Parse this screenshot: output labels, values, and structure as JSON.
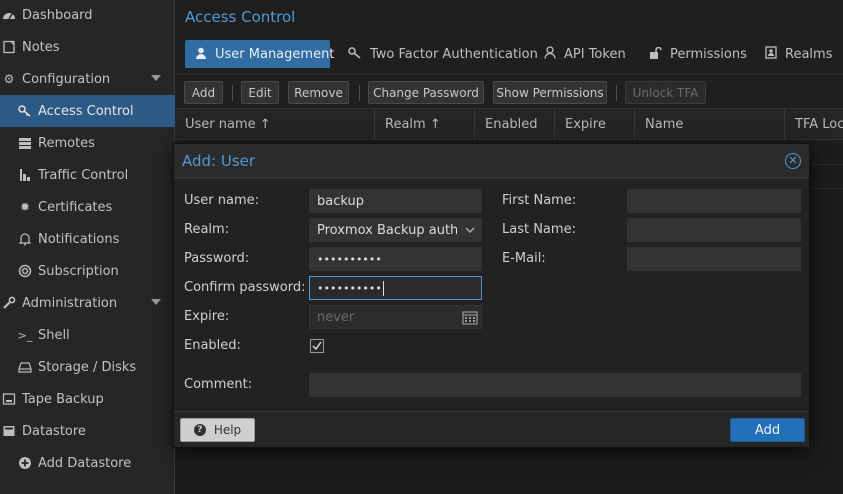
{
  "sidebar": {
    "items": [
      {
        "label": "Dashboard",
        "icon": "dashboard-icon"
      },
      {
        "label": "Notes",
        "icon": "notes-icon"
      },
      {
        "label": "Configuration",
        "icon": "gears-icon"
      },
      {
        "label": "Access Control",
        "icon": "key-icon"
      },
      {
        "label": "Remotes",
        "icon": "server-icon"
      },
      {
        "label": "Traffic Control",
        "icon": "signal-icon"
      },
      {
        "label": "Certificates",
        "icon": "certificate-icon"
      },
      {
        "label": "Notifications",
        "icon": "bell-icon"
      },
      {
        "label": "Subscription",
        "icon": "support-icon"
      },
      {
        "label": "Administration",
        "icon": "wrench-icon"
      },
      {
        "label": "Shell",
        "icon": "terminal-icon"
      },
      {
        "label": "Storage / Disks",
        "icon": "hdd-icon"
      },
      {
        "label": "Tape Backup",
        "icon": "tape-icon"
      },
      {
        "label": "Datastore",
        "icon": "database-icon"
      },
      {
        "label": "Add Datastore",
        "icon": "plus-circle-icon"
      }
    ]
  },
  "main": {
    "title": "Access Control",
    "tabs": [
      {
        "label": "User Management",
        "icon": "user-icon"
      },
      {
        "label": "Two Factor Authentication",
        "icon": "key-icon"
      },
      {
        "label": "API Token",
        "icon": "user-outline-icon"
      },
      {
        "label": "Permissions",
        "icon": "unlock-icon"
      },
      {
        "label": "Realms",
        "icon": "address-book-icon"
      }
    ],
    "toolbar": {
      "add": "Add",
      "edit": "Edit",
      "remove": "Remove",
      "change_password": "Change Password",
      "show_permissions": "Show Permissions",
      "unlock_tfa": "Unlock TFA"
    },
    "columns": [
      "User name ↑",
      "Realm ↑",
      "Enabled",
      "Expire",
      "Name",
      "TFA Lock"
    ]
  },
  "dialog": {
    "title": "Add: User",
    "labels": {
      "username": "User name:",
      "realm": "Realm:",
      "password": "Password:",
      "confirm": "Confirm password:",
      "expire": "Expire:",
      "enabled": "Enabled:",
      "comment": "Comment:",
      "first_name": "First Name:",
      "last_name": "Last Name:",
      "email": "E-Mail:"
    },
    "values": {
      "username": "backup",
      "realm": "Proxmox Backup authen",
      "password": "••••••••••",
      "confirm": "••••••••••",
      "expire_placeholder": "never",
      "first_name": "",
      "last_name": "",
      "email": "",
      "comment": ""
    },
    "enabled_checked": true,
    "help": "Help",
    "submit": "Add"
  },
  "colors": {
    "accent": "#4f9ad8",
    "active_nav": "#2a5a85",
    "primary_button": "#2470b8"
  }
}
